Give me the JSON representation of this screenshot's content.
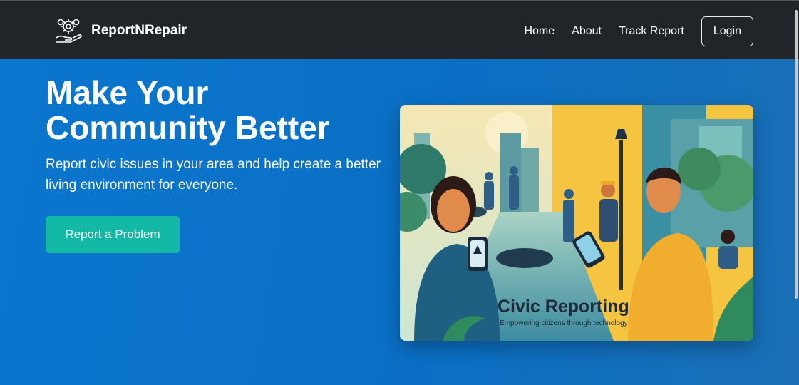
{
  "brand": {
    "name": "ReportNRepair",
    "icon": "gears-hand-icon"
  },
  "nav": {
    "items": [
      "Home",
      "About",
      "Track Report"
    ],
    "login_label": "Login"
  },
  "hero": {
    "title": "Make Your Community Better",
    "subtitle": "Report civic issues in your area and help create a better living environment for everyone.",
    "cta_label": "Report a Problem"
  },
  "illustration": {
    "heading": "Civic Reporting",
    "tagline": "Empowering citizens through technology"
  },
  "colors": {
    "navbar": "#212529",
    "hero": "#0a6fc4",
    "accent": "#14b8a6",
    "illustration_yellow": "#f5c542"
  }
}
